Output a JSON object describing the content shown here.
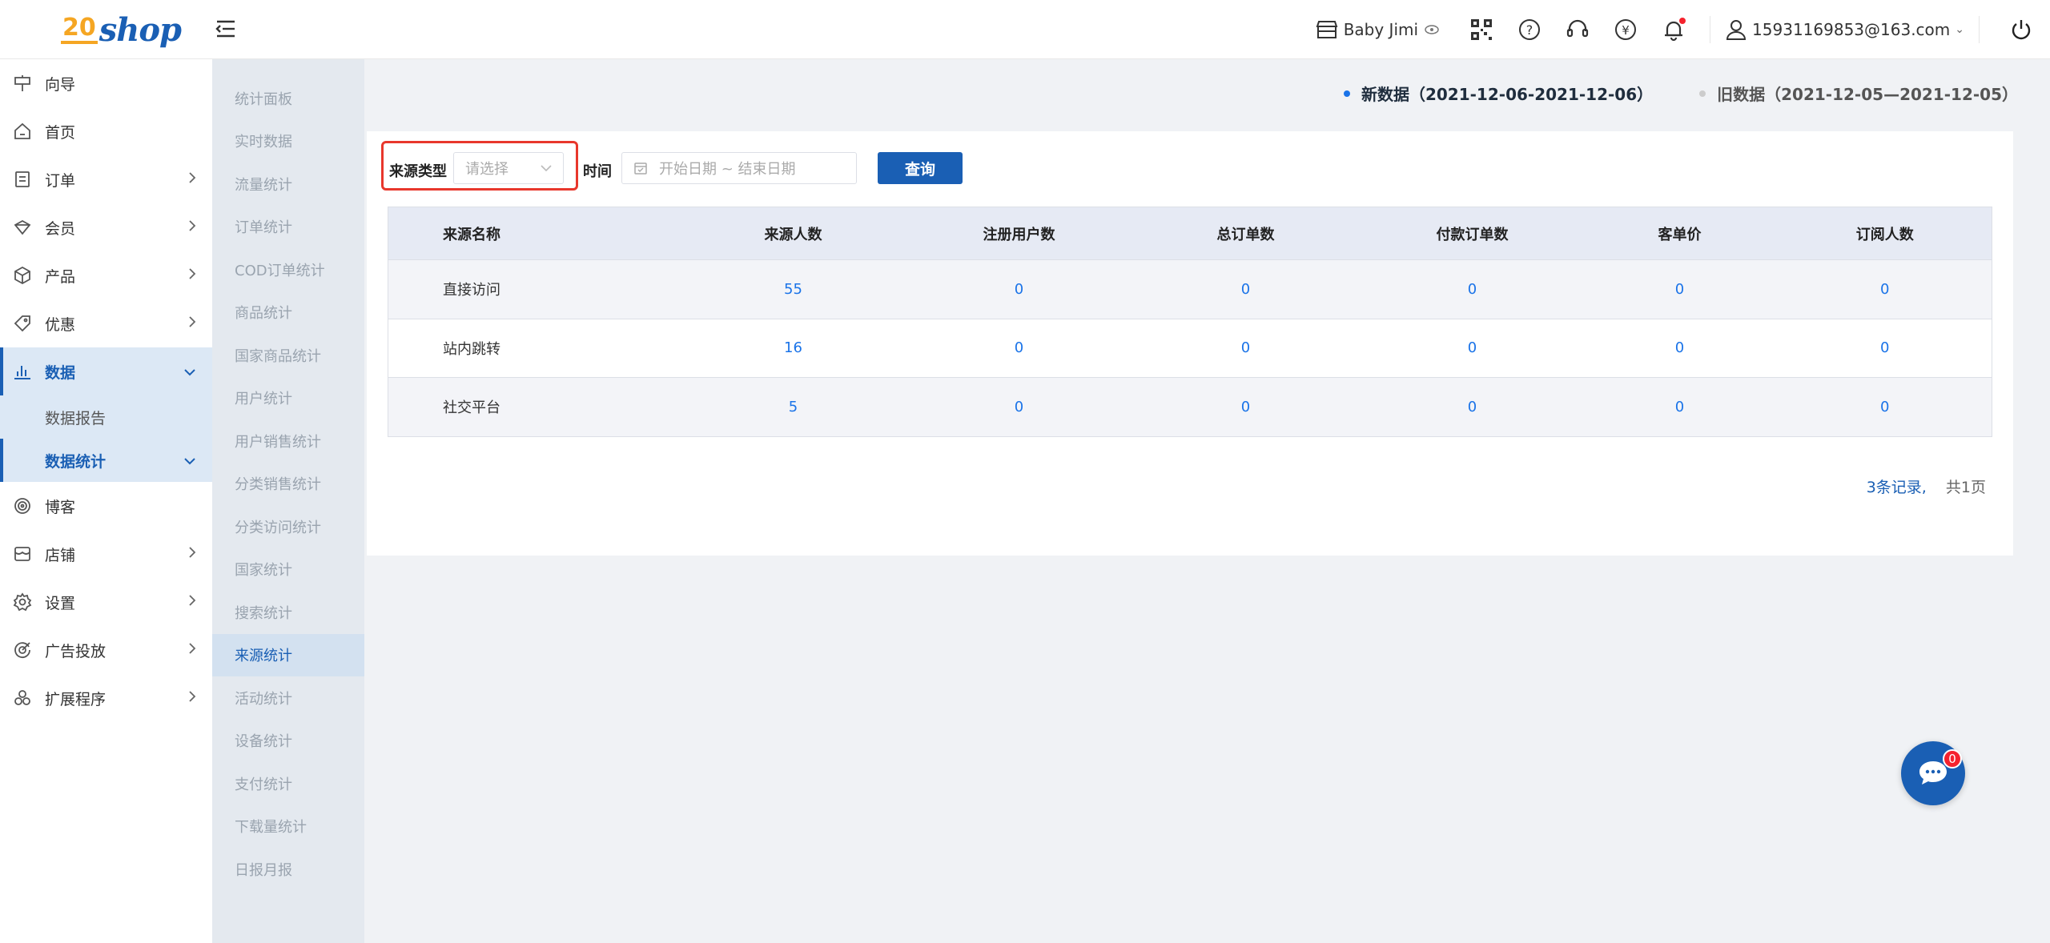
{
  "brand": {
    "badge": "20",
    "word": "shop"
  },
  "header": {
    "store_name": "Baby Jimi",
    "user_email": "15931169853@163.com"
  },
  "sidebar": {
    "items": [
      {
        "label": "向导",
        "icon": "signpost-icon"
      },
      {
        "label": "首页",
        "icon": "home-icon"
      },
      {
        "label": "订单",
        "icon": "order-icon"
      },
      {
        "label": "会员",
        "icon": "member-icon"
      },
      {
        "label": "产品",
        "icon": "product-box-icon"
      },
      {
        "label": "优惠",
        "icon": "tag-icon"
      },
      {
        "label": "数据",
        "icon": "bar-chart-icon"
      },
      {
        "label": "博客",
        "icon": "blog-icon"
      },
      {
        "label": "店铺",
        "icon": "shop-icon"
      },
      {
        "label": "设置",
        "icon": "gear-icon"
      },
      {
        "label": "广告投放",
        "icon": "target-icon"
      },
      {
        "label": "扩展程序",
        "icon": "extension-icon"
      }
    ],
    "data_children": [
      {
        "label": "数据报告"
      },
      {
        "label": "数据统计"
      }
    ]
  },
  "submenu": {
    "items": [
      "统计面板",
      "实时数据",
      "流量统计",
      "订单统计",
      "COD订单统计",
      "商品统计",
      "国家商品统计",
      "用户统计",
      "用户销售统计",
      "分类销售统计",
      "分类访问统计",
      "国家统计",
      "搜索统计",
      "来源统计",
      "活动统计",
      "设备统计",
      "支付统计",
      "下载量统计",
      "日报月报"
    ]
  },
  "legend": {
    "new_label": "新数据（2021-12-06-2021-12-06）",
    "old_label": "旧数据（2021-12-05—2021-12-05）",
    "new_color": "#1a73e8",
    "old_color": "#cccccc"
  },
  "filter": {
    "source_type_label": "来源类型",
    "source_type_placeholder": "请选择",
    "time_label": "时间",
    "date_placeholder": "开始日期 ~ 结束日期",
    "query_button": "查询"
  },
  "table": {
    "headers": [
      "来源名称",
      "来源人数",
      "注册用户数",
      "总订单数",
      "付款订单数",
      "客单价",
      "订阅人数"
    ],
    "rows": [
      [
        "直接访问",
        "55",
        "0",
        "0",
        "0",
        "0",
        "0"
      ],
      [
        "站内跳转",
        "16",
        "0",
        "0",
        "0",
        "0",
        "0"
      ],
      [
        "社交平台",
        "5",
        "0",
        "0",
        "0",
        "0",
        "0"
      ]
    ]
  },
  "pager": {
    "records": "3条记录,",
    "pages": "共1页"
  },
  "chat": {
    "unread": "0"
  },
  "colors": {
    "primary": "#1a5fb4",
    "link": "#1a73e8",
    "highlight_border": "#e8372c",
    "badge_red": "#f5222d"
  }
}
